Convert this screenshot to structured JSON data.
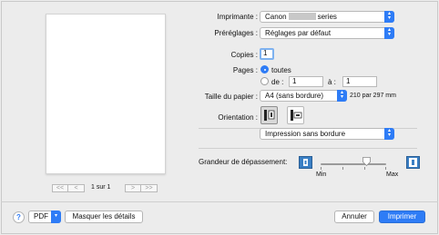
{
  "preview": {
    "page_counter": "1 sur 1",
    "nav_first": "<<",
    "nav_prev": "<",
    "nav_next": ">",
    "nav_last": ">>"
  },
  "form": {
    "printer_label": "Imprimante :",
    "printer_value_prefix": "Canon",
    "printer_value_suffix": "series",
    "presets_label": "Préréglages :",
    "presets_value": "Réglages par défaut",
    "copies_label": "Copies :",
    "copies_value": "1",
    "pages_label": "Pages :",
    "pages_all": "toutes",
    "pages_from": "de :",
    "pages_from_value": "1",
    "pages_to": "à :",
    "pages_to_value": "1",
    "paper_label": "Taille du papier :",
    "paper_value": "A4 (sans bordure)",
    "paper_dims": "210 par 297 mm",
    "orientation_label": "Orientation :",
    "section_value": "Impression sans bordure",
    "overflow_label": "Grandeur de dépassement:",
    "slider_min": "Min",
    "slider_max": "Max",
    "slider_level": 0.7
  },
  "footer": {
    "help_label": "?",
    "pdf_label": "PDF",
    "details_label": "Masquer les détails",
    "cancel_label": "Annuler",
    "print_label": "Imprimer"
  },
  "colors": {
    "accent": "#2e7cf6",
    "background": "#ececec"
  }
}
